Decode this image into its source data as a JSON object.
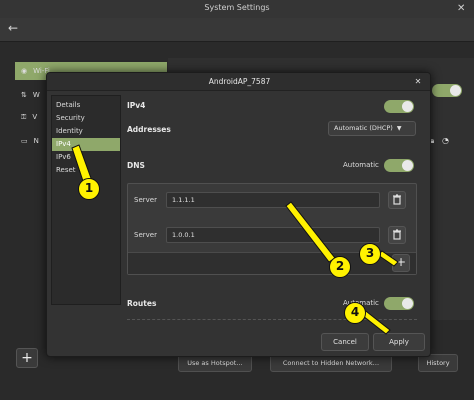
{
  "window": {
    "title": "System Settings",
    "close_glyph": "✕",
    "back_glyph": "←"
  },
  "sidebar": {
    "items": [
      {
        "label": "Wi-Fi",
        "selected": true
      },
      {
        "label": "W",
        "selected": false
      },
      {
        "label": "V",
        "selected": false
      },
      {
        "label": "N",
        "selected": false
      }
    ]
  },
  "bottom_bar": {
    "add_label": "+",
    "hotspot_label": "Use as Hotspot…",
    "hidden_network_label": "Connect to Hidden Network…",
    "history_label": "History"
  },
  "dialog": {
    "title": "AndroidAP_7587",
    "close_glyph": "✕",
    "nav": [
      {
        "label": "Details",
        "selected": false
      },
      {
        "label": "Security",
        "selected": false
      },
      {
        "label": "Identity",
        "selected": false
      },
      {
        "label": "IPv4",
        "selected": true
      },
      {
        "label": "IPv6",
        "selected": false
      },
      {
        "label": "Reset",
        "selected": false
      }
    ],
    "ipv4_label": "IPv4",
    "addresses_label": "Addresses",
    "addresses_value": "Automatic (DHCP)",
    "dns_label": "DNS",
    "dns_auto_label": "Automatic",
    "servers": [
      {
        "label": "Server",
        "value": "1.1.1.1"
      },
      {
        "label": "Server",
        "value": "1.0.0.1"
      }
    ],
    "add_server_glyph": "+",
    "routes_label": "Routes",
    "routes_auto_label": "Automatic",
    "cancel_label": "Cancel",
    "apply_label": "Apply"
  },
  "callouts": [
    "1",
    "2",
    "3",
    "4"
  ],
  "colors": {
    "accent": "#8fa86a",
    "callout": "#fff200"
  }
}
